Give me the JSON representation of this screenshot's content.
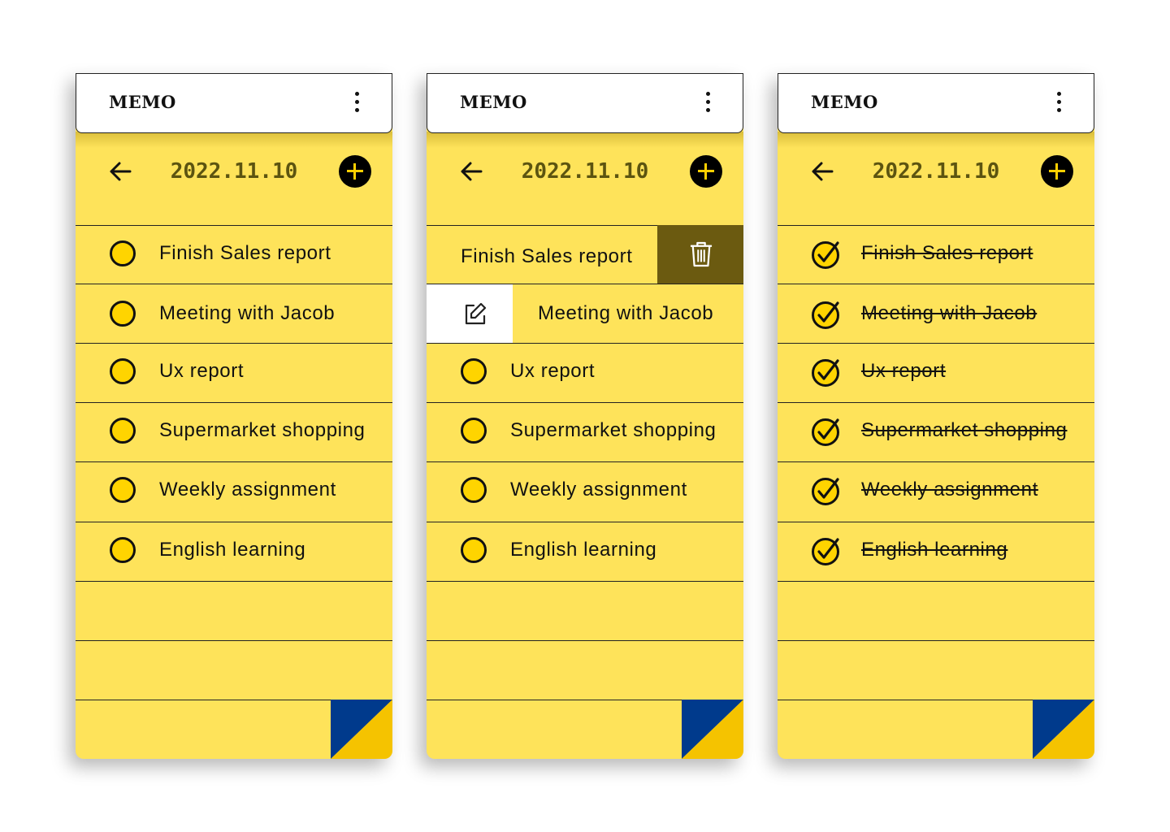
{
  "app": {
    "title": "MEMO"
  },
  "date": "2022.11.10",
  "colors": {
    "note": "#FEE35A",
    "check_fill": "#FFD400",
    "date_text": "#5C5410",
    "corner_blue": "#003A8C",
    "corner_yellow": "#F5C300",
    "delete_bg": "#6B5A10"
  },
  "icons": {
    "menu": "more-vertical-icon",
    "back": "arrow-left-icon",
    "add": "plus-circle-icon",
    "delete": "trash-icon",
    "edit": "edit-icon",
    "done": "check-circle-icon",
    "todo": "circle-icon"
  },
  "screens": [
    {
      "state": "default",
      "tasks": [
        "Finish Sales report",
        "Meeting with Jacob",
        "Ux report",
        "Supermarket shopping",
        "Weekly assignment",
        "English learning"
      ]
    },
    {
      "state": "swipe-actions",
      "tasks": [
        "Finish Sales report",
        "Meeting with Jacob",
        "Ux report",
        "Supermarket shopping",
        "Weekly assignment",
        "English learning"
      ]
    },
    {
      "state": "completed",
      "tasks": [
        "Finish Sales report",
        "Meeting with Jacob",
        "Ux report",
        "Supermarket shopping",
        "Weekly assignment",
        "English learning"
      ]
    }
  ]
}
